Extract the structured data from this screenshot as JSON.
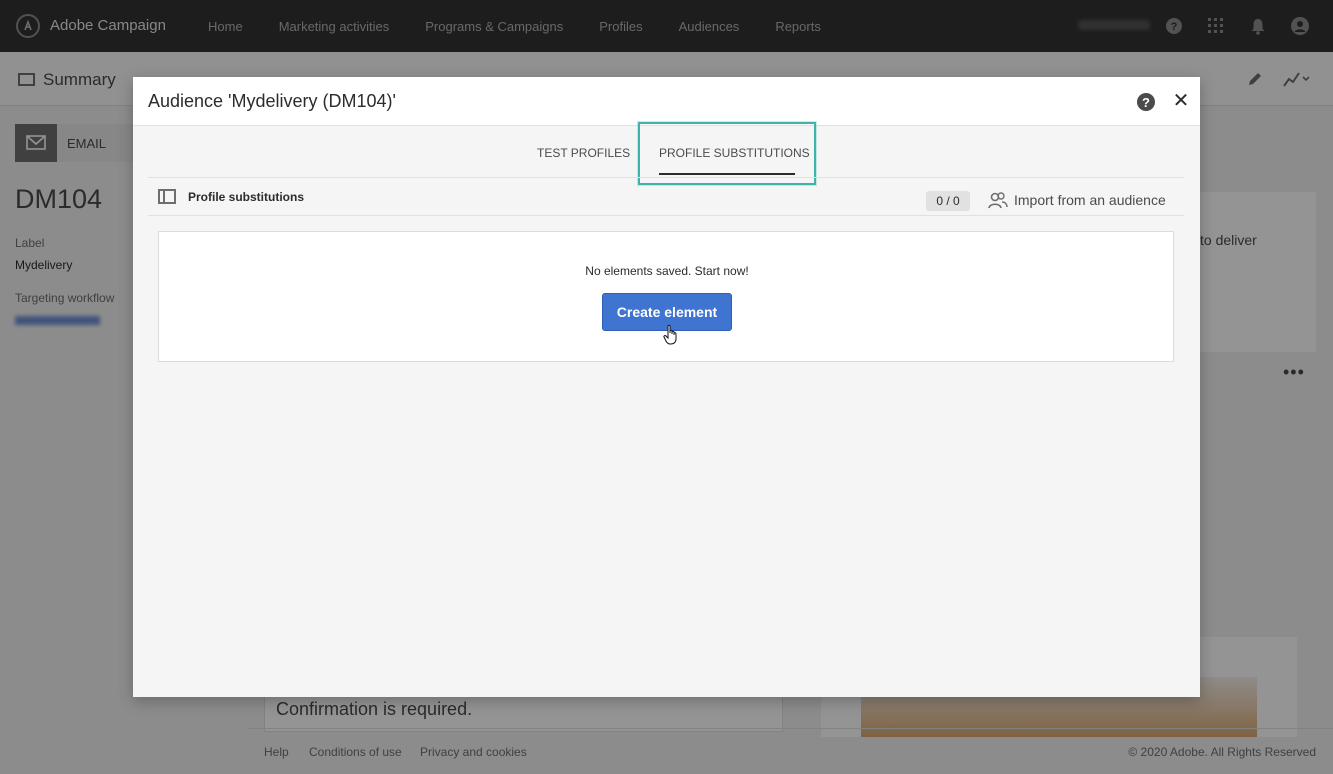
{
  "app": {
    "name": "Adobe Campaign",
    "logo_glyph": "AC",
    "nav": [
      "Home",
      "Marketing activities",
      "Programs & Campaigns",
      "Profiles",
      "Audiences",
      "Reports"
    ]
  },
  "background": {
    "summary_title": "Summary",
    "channel_label": "EMAIL",
    "code": "DM104",
    "label_caption": "Label",
    "label_value": "Mydelivery",
    "workflow_caption": "Targeting workflow",
    "right_panel_text": "to deliver",
    "more_menu": "•••",
    "confirmation_text": "Confirmation is required.",
    "footer": {
      "help": "Help",
      "conditions": "Conditions of use",
      "privacy": "Privacy and cookies",
      "copyright": "© 2020 Adobe. All Rights Reserved"
    }
  },
  "modal": {
    "title": "Audience 'Mydelivery (DM104)'",
    "help_glyph": "?",
    "close_glyph": "✕",
    "tabs": [
      {
        "label": "TEST PROFILES",
        "active": false
      },
      {
        "label": "PROFILE SUBSTITUTIONS",
        "active": true
      }
    ],
    "section_title": "Profile substitutions",
    "count": "0 / 0",
    "import_label": "Import from an audience",
    "empty_message": "No elements saved. Start now!",
    "create_button": "Create element"
  },
  "colors": {
    "topbar": "#323232",
    "primary_button": "#3f74d0",
    "highlight": "#3cb5a8"
  },
  "icons": [
    "help-icon",
    "apps-grid-icon",
    "bell-icon",
    "user-icon",
    "close-icon",
    "panel-icon",
    "users-import-icon",
    "pencil-icon",
    "chart-icon"
  ]
}
